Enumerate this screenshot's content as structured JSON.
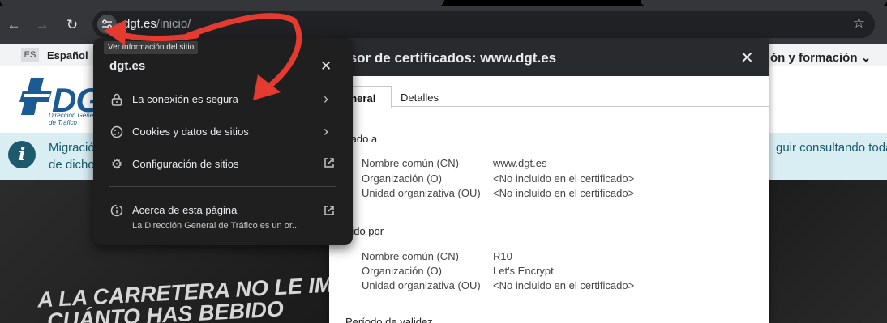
{
  "toolbar": {
    "back_glyph": "←",
    "forward_glyph": "→",
    "reload_glyph": "↻",
    "url_domain": "dgt.es",
    "url_path": "/inicio/",
    "star_glyph": "☆",
    "site_info_icon": "tune-icon"
  },
  "translate_bar": {
    "lang_code": "ES",
    "lang_name": "Español"
  },
  "page": {
    "logo": "DGT",
    "logo_sub1": "Dirección General",
    "logo_sub2": "de Tráfico",
    "nav_right": "ón y formación",
    "notice_icon": "i",
    "notice_l1": "Migració",
    "notice_l2": "de dicho",
    "notice_r1": "guir consultando toda",
    "banner_l1": "A LA CARRETERA NO LE IM",
    "banner_l2": "CUÁNTO HAS BEBIDO"
  },
  "cert": {
    "title": "isor de certificados: www.dgt.es",
    "tab_general": "eneral",
    "tab_detalles": "Detalles",
    "issued_to": {
      "heading": "nviado a",
      "rows": [
        {
          "k": "Nombre común (CN)",
          "v": "www.dgt.es"
        },
        {
          "k": "Organización (O)",
          "v": "<No incluido en el certificado>"
        },
        {
          "k": "Unidad organizativa (OU)",
          "v": "<No incluido en el certificado>"
        }
      ]
    },
    "issued_by": {
      "heading": "mitido por",
      "rows": [
        {
          "k": "Nombre común (CN)",
          "v": "R10"
        },
        {
          "k": "Organización (O)",
          "v": "Let's Encrypt"
        },
        {
          "k": "Unidad organizativa (OU)",
          "v": "<No incluido en el certificado>"
        }
      ]
    },
    "validity_heading": "Período de validez"
  },
  "popup": {
    "domain": "dgt.es",
    "items": [
      {
        "label": "La conexión es segura",
        "icon": "lock-icon"
      },
      {
        "label": "Cookies y datos de sitios",
        "icon": "cookie-icon"
      },
      {
        "label": "Configuración de sitios",
        "icon": "gear-icon"
      }
    ],
    "about_label": "Acerca de esta página",
    "about_sub": "La Dirección General de Tráfico es un or..."
  },
  "tooltip": "Ver información del sitio",
  "colors": {
    "annotation_arrow": "#e53a2f",
    "brand": "#1a5b93"
  }
}
